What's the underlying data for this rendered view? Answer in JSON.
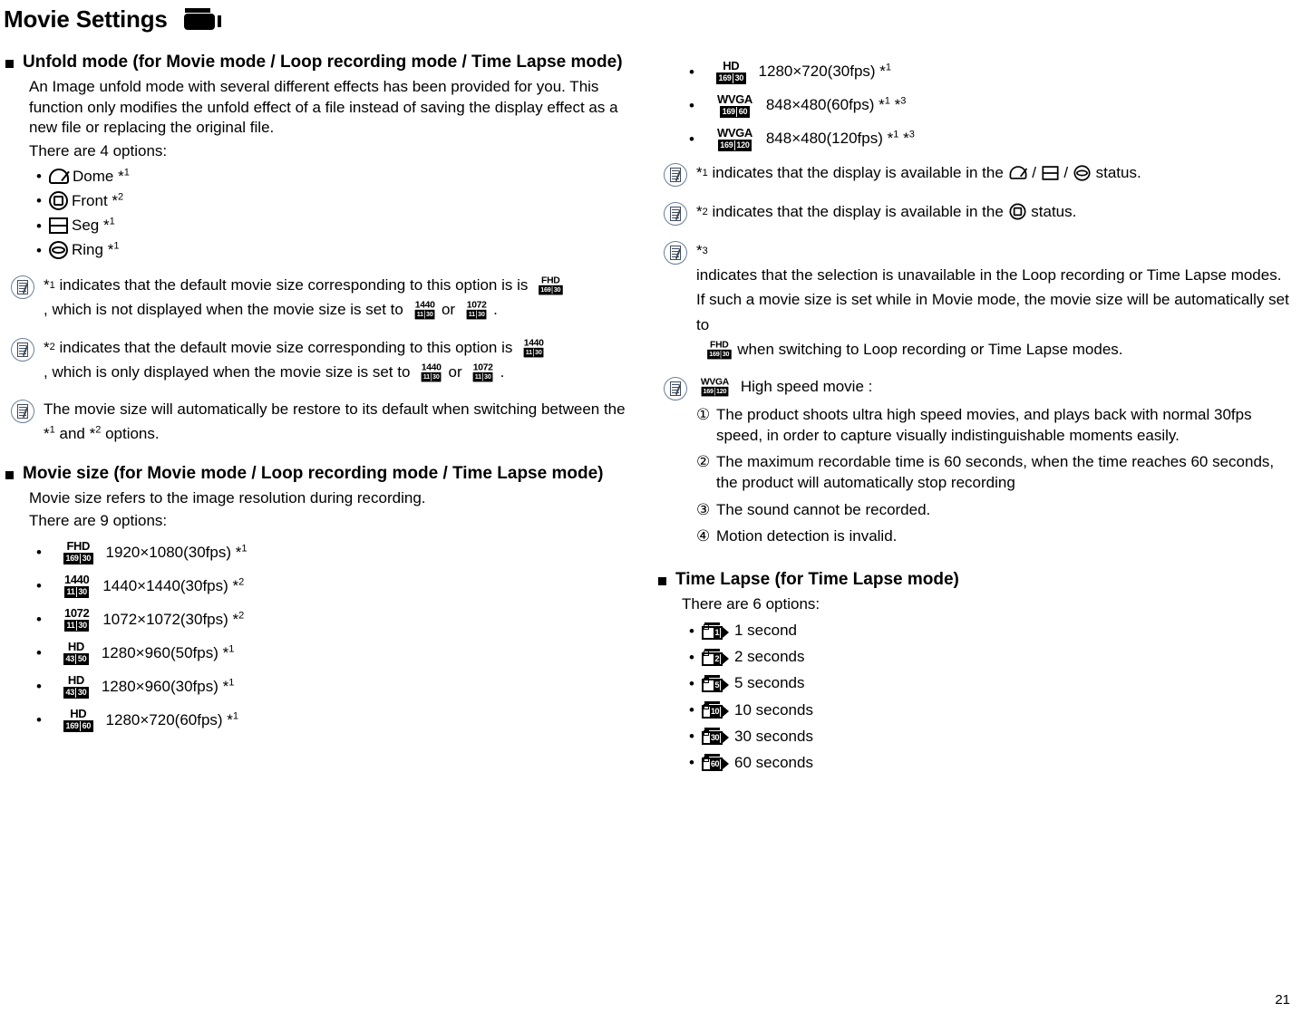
{
  "page": {
    "title": "Movie Settings",
    "title_icon": "camcorder-icon",
    "page_number": "21"
  },
  "left": {
    "unfold": {
      "heading": "Unfold mode (for Movie mode / Loop recording mode / Time Lapse mode)",
      "intro": "An Image unfold mode with several different effects has been provided for you. This function only modifies the unfold effect of a file instead of saving the display effect as a new file or replacing the original file.",
      "count_line": "There are 4 options:",
      "options": [
        {
          "icon": "dome-icon",
          "label": "Dome",
          "note_ref": "1"
        },
        {
          "icon": "front-icon",
          "label": "Front",
          "note_ref": "2"
        },
        {
          "icon": "seg-icon",
          "label": "Seg",
          "note_ref": "1"
        },
        {
          "icon": "ring-icon",
          "label": "Ring",
          "note_ref": "1"
        }
      ],
      "notes": [
        {
          "ref": "1",
          "part1": "indicates that the default movie size corresponding to this option is",
          "badge1": {
            "name": "FHD",
            "ratio": "169",
            "fps": "30"
          },
          "part2": ", which is not displayed when the movie size is set to",
          "badge2": {
            "name": "1440",
            "ratio": "11",
            "fps": "30"
          },
          "part3": "or",
          "badge3": {
            "name": "1072",
            "ratio": "11",
            "fps": "30"
          },
          "part4": "."
        },
        {
          "ref": "2",
          "part1": "indicates that the default movie size corresponding to this option is",
          "badge1": {
            "name": "1440",
            "ratio": "11",
            "fps": "30"
          },
          "part2": ", which is only displayed when the movie size is set to",
          "badge2": {
            "name": "1440",
            "ratio": "11",
            "fps": "30"
          },
          "part3": "or",
          "badge3": {
            "name": "1072",
            "ratio": "11",
            "fps": "30"
          },
          "part4": "."
        }
      ],
      "restore_note": {
        "part1": "The movie size will automatically be restore to its default when switching between the",
        "ref1": "1",
        "mid": "and",
        "ref2": "2",
        "part2": "options."
      }
    },
    "movie_size": {
      "heading": "Movie size (for Movie mode / Loop recording mode / Time Lapse mode)",
      "intro": "Movie size refers to the image resolution during recording.",
      "count_line": "There are 9 options:",
      "options": [
        {
          "badge": {
            "name": "FHD",
            "ratio": "169",
            "fps": "30"
          },
          "label": "1920×1080(30fps)",
          "refs": [
            "1"
          ]
        },
        {
          "badge": {
            "name": "1440",
            "ratio": "11",
            "fps": "30"
          },
          "label": "1440×1440(30fps)",
          "refs": [
            "2"
          ]
        },
        {
          "badge": {
            "name": "1072",
            "ratio": "11",
            "fps": "30"
          },
          "label": "1072×1072(30fps)",
          "refs": [
            "2"
          ]
        },
        {
          "badge": {
            "name": "HD",
            "ratio": "43",
            "fps": "50"
          },
          "label": "1280×960(50fps)",
          "refs": [
            "1"
          ]
        },
        {
          "badge": {
            "name": "HD",
            "ratio": "43",
            "fps": "30"
          },
          "label": "1280×960(30fps)",
          "refs": [
            "1"
          ]
        },
        {
          "badge": {
            "name": "HD",
            "ratio": "169",
            "fps": "60"
          },
          "label": "1280×720(60fps)",
          "refs": [
            "1"
          ]
        }
      ]
    }
  },
  "right": {
    "movie_size_cont": {
      "options": [
        {
          "badge": {
            "name": "HD",
            "ratio": "169",
            "fps": "30"
          },
          "label": "1280×720(30fps)",
          "refs": [
            "1"
          ]
        },
        {
          "badge": {
            "name": "WVGA",
            "ratio": "169",
            "fps": "60"
          },
          "label": "848×480(60fps)",
          "refs": [
            "1",
            "3"
          ]
        },
        {
          "badge": {
            "name": "WVGA",
            "ratio": "169",
            "fps": "120"
          },
          "label": "848×480(120fps)",
          "refs": [
            "1",
            "3"
          ]
        }
      ],
      "notes": [
        {
          "ref": "1",
          "part1": "indicates that the display is available in the",
          "icons": [
            "dome-icon",
            "seg-icon",
            "ring-icon"
          ],
          "part2": "status."
        },
        {
          "ref": "2",
          "part1": "indicates that the display is available in the",
          "icons": [
            "front-icon"
          ],
          "part2": "status."
        }
      ],
      "note3": {
        "ref": "3",
        "part1": "indicates that the selection is unavailable in the Loop recording or Time Lapse modes. If such a movie size is set while in Movie mode, the movie size will be automatically set to",
        "badge": {
          "name": "FHD",
          "ratio": "169",
          "fps": "30"
        },
        "part2": "when switching to Loop recording or Time Lapse modes."
      },
      "high_speed": {
        "badge": {
          "name": "WVGA",
          "ratio": "169",
          "fps": "120"
        },
        "title": "High speed movie :",
        "items": [
          {
            "num": "①",
            "text": "The product shoots ultra high speed movies, and plays back with normal 30fps speed, in order to capture visually indistinguishable moments easily."
          },
          {
            "num": "②",
            "text": "The maximum recordable time is 60 seconds, when the time reaches 60 seconds, the product will automatically stop recording"
          },
          {
            "num": "③",
            "text": "The sound cannot be recorded."
          },
          {
            "num": "④",
            "text": "Motion detection is invalid."
          }
        ]
      }
    },
    "time_lapse": {
      "heading": "Time Lapse (for Time Lapse mode)",
      "count_line": "There are 6 options:",
      "options": [
        {
          "icon_number": "1",
          "label": "1 second"
        },
        {
          "icon_number": "2",
          "label": "2 seconds"
        },
        {
          "icon_number": "5",
          "label": "5 seconds"
        },
        {
          "icon_number": "10",
          "label": "10 seconds"
        },
        {
          "icon_number": "30",
          "label": "30 seconds"
        },
        {
          "icon_number": "60",
          "label": "60 seconds"
        }
      ]
    }
  }
}
